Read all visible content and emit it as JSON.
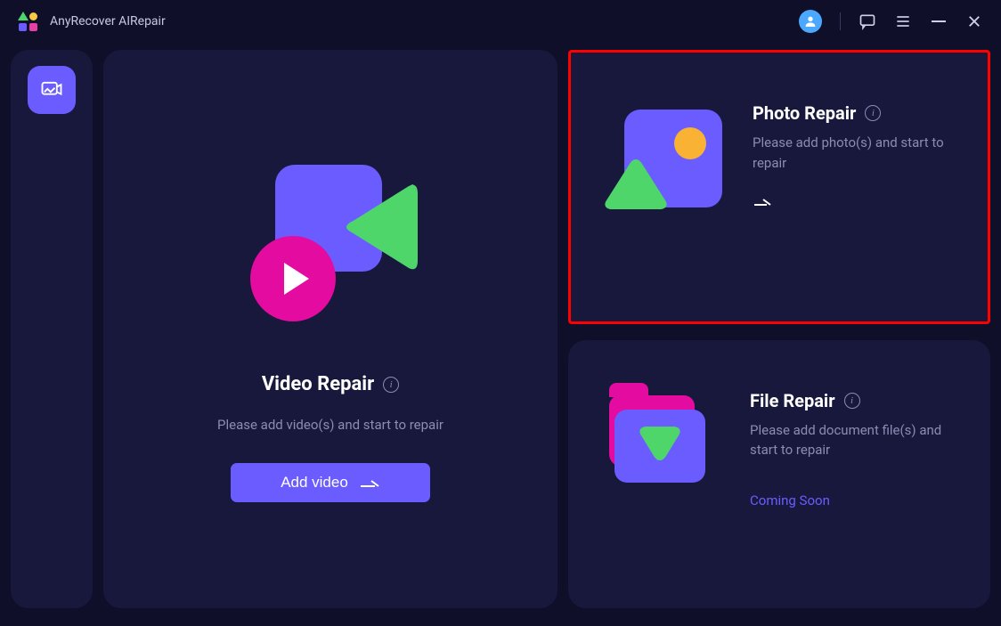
{
  "app": {
    "title": "AnyRecover AIRepair"
  },
  "main": {
    "title": "Video Repair",
    "subtitle": "Please add video(s) and start to repair",
    "button": "Add video"
  },
  "photo": {
    "title": "Photo Repair",
    "subtitle": "Please add photo(s) and start to repair"
  },
  "file": {
    "title": "File Repair",
    "subtitle": "Please add document file(s) and start to repair",
    "soon": "Coming Soon"
  }
}
